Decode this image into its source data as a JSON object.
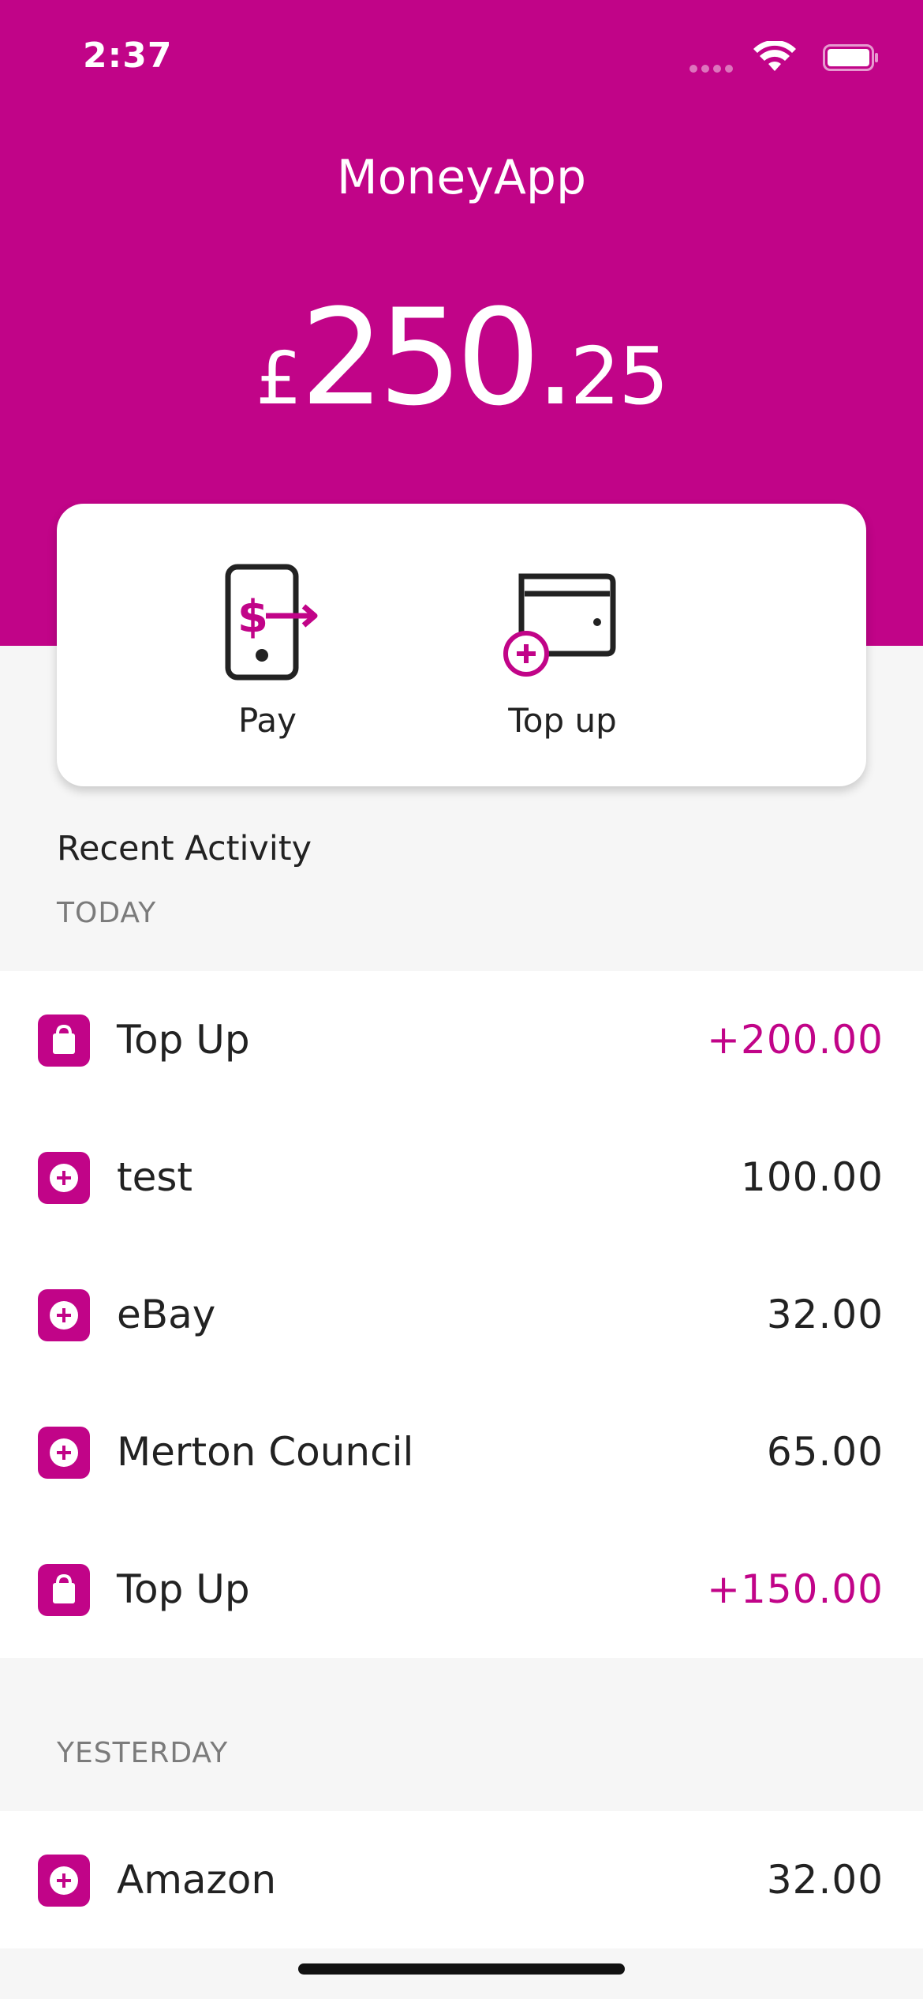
{
  "status_bar": {
    "time": "2:37",
    "icons": [
      "signal-icon",
      "wifi-icon",
      "battery-icon"
    ]
  },
  "header": {
    "title": "MoneyApp"
  },
  "balance": {
    "currency": "£",
    "whole": "250.",
    "fraction": "25"
  },
  "actions": [
    {
      "label": "Pay",
      "icon": "pay-phone-icon"
    },
    {
      "label": "Top up",
      "icon": "wallet-topup-icon"
    }
  ],
  "activity": {
    "title": "Recent Activity",
    "groups": [
      {
        "label": "TODAY",
        "items": [
          {
            "name": "Top Up",
            "amount": "+200.00",
            "icon": "shopping-bag-icon",
            "credit": true
          },
          {
            "name": "test",
            "amount": "100.00",
            "icon": "plus-circle-icon",
            "credit": false
          },
          {
            "name": "eBay",
            "amount": "32.00",
            "icon": "plus-circle-icon",
            "credit": false
          },
          {
            "name": "Merton Council",
            "amount": "65.00",
            "icon": "plus-circle-icon",
            "credit": false
          },
          {
            "name": "Top Up",
            "amount": "+150.00",
            "icon": "shopping-bag-icon",
            "credit": true
          }
        ]
      },
      {
        "label": "YESTERDAY",
        "items": [
          {
            "name": "Amazon",
            "amount": "32.00",
            "icon": "plus-circle-icon",
            "credit": false
          }
        ]
      }
    ]
  },
  "colors": {
    "brand": "#c10488",
    "background": "#f6f6f6",
    "card": "#ffffff",
    "text": "#222222",
    "muted": "#7b7b7b"
  }
}
